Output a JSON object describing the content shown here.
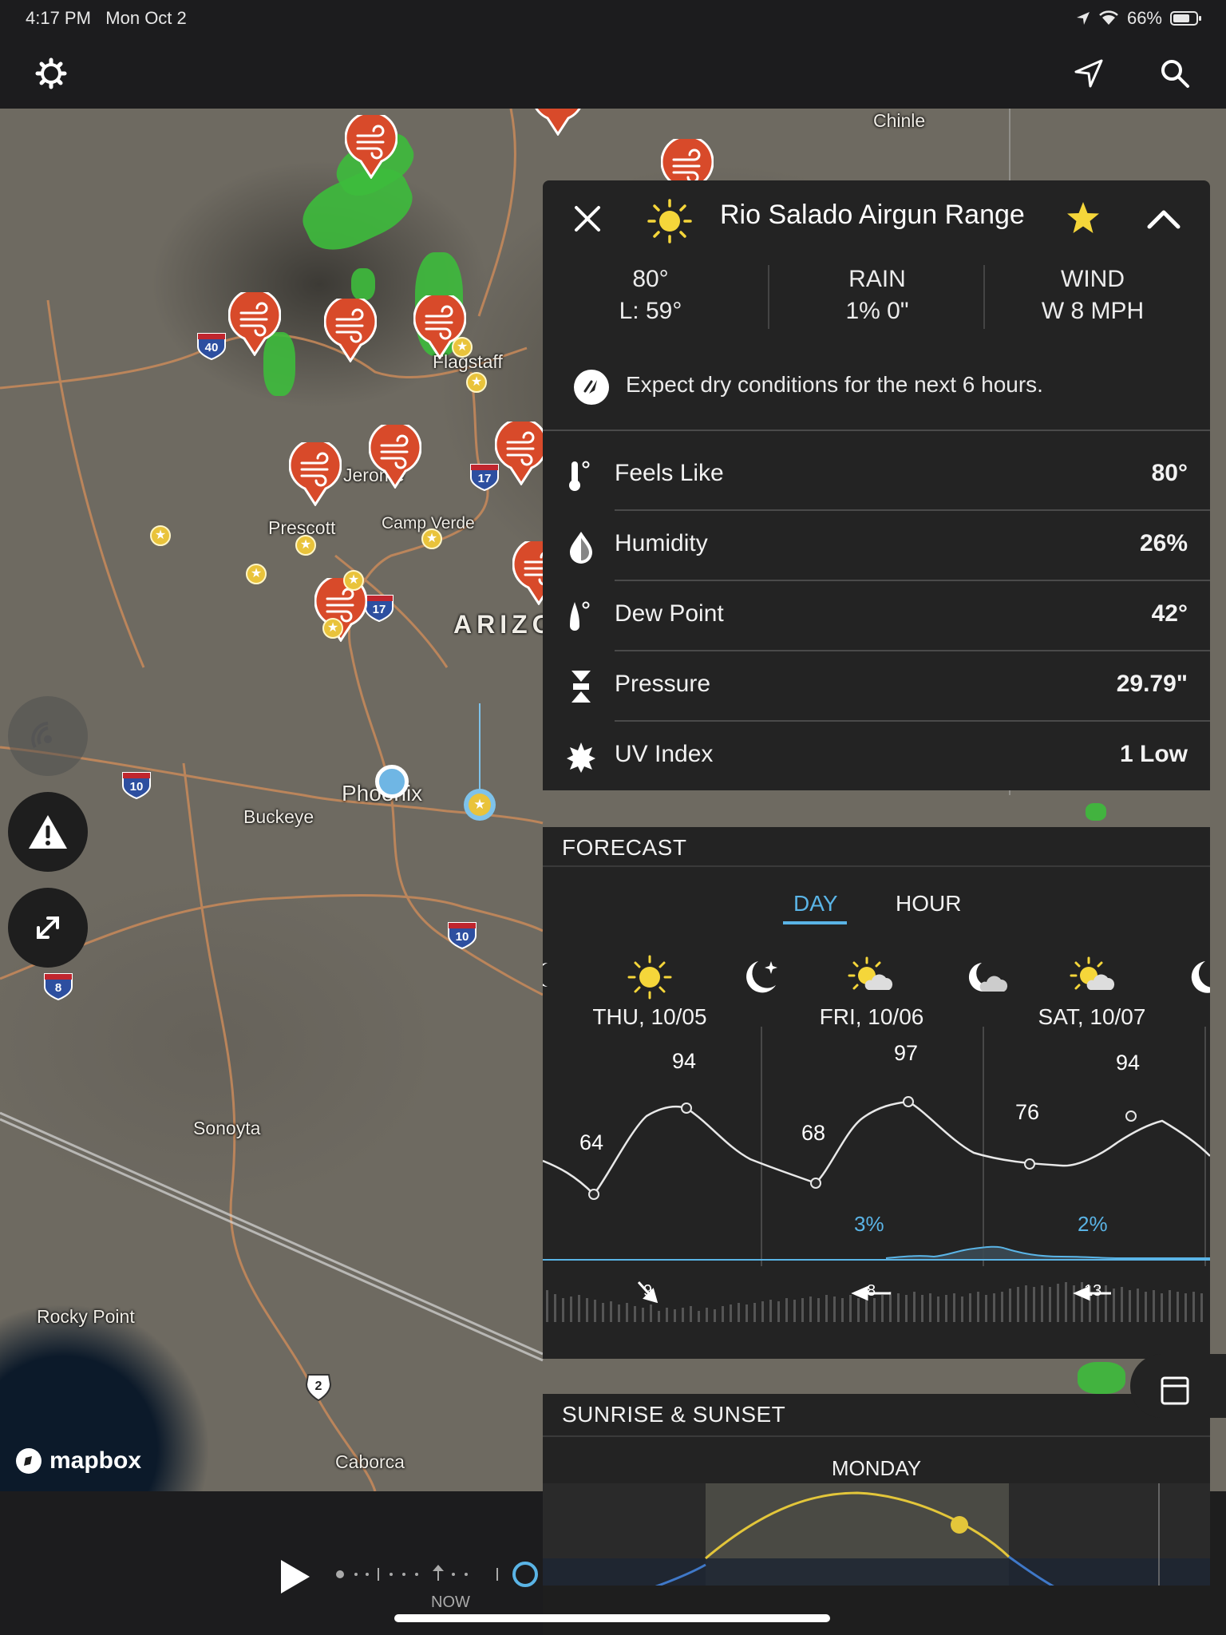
{
  "status": {
    "time": "4:17 PM",
    "date": "Mon Oct 2",
    "battery": "66%"
  },
  "map": {
    "labels": {
      "chinle": "Chinle",
      "flagstaff": "Flagstaff",
      "jerome": "Jerome",
      "prescott": "Prescott",
      "camp_verde": "Camp Verde",
      "arizona": "ARIZO",
      "phoenix": "Phoenix",
      "buckeye": "Buckeye",
      "sonoyta": "Sonoyta",
      "rocky_point": "Rocky Point",
      "caborca": "Caborca"
    },
    "shields": {
      "i40": "40",
      "i17a": "17",
      "i17b": "17",
      "i10a": "10",
      "i10b": "10",
      "i8": "8",
      "mx2": "2"
    },
    "attribution": "mapbox"
  },
  "timeline": {
    "now_label": "NOW"
  },
  "details": {
    "location": "Rio Salado Airgun Range",
    "temp": "80°",
    "low": "L: 59°",
    "rain_label": "RAIN",
    "rain_value": "1% 0\"",
    "wind_label": "WIND",
    "wind_value": "W 8 MPH",
    "message": "Expect dry conditions for the next 6 hours.",
    "rows": [
      {
        "label": "Feels Like",
        "value": "80°"
      },
      {
        "label": "Humidity",
        "value": "26%"
      },
      {
        "label": "Dew Point",
        "value": "42°"
      },
      {
        "label": "Pressure",
        "value": "29.79\""
      },
      {
        "label": "UV Index",
        "value": "1 Low"
      }
    ]
  },
  "forecast": {
    "title": "FORECAST",
    "tabs": [
      "DAY",
      "HOUR"
    ],
    "days": [
      "THU, 10/05",
      "FRI, 10/06",
      "SAT, 10/07"
    ],
    "temps": [
      "64",
      "94",
      "68",
      "97",
      "76",
      "94"
    ],
    "precip": [
      "3%",
      "2%"
    ],
    "winds": [
      "9",
      "8",
      "13"
    ],
    "colors": {
      "accent": "#5ab4e6",
      "temp_line": "#e8e8e8"
    }
  },
  "sunrise": {
    "title": "SUNRISE & SUNSET",
    "day": "MONDAY"
  }
}
